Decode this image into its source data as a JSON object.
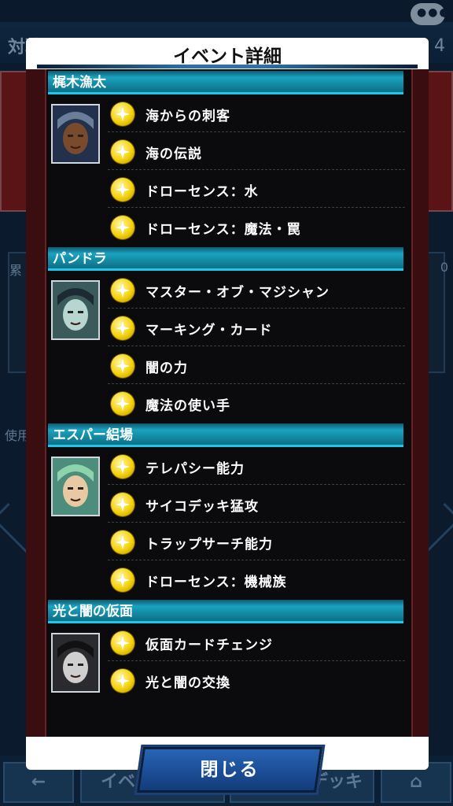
{
  "background": {
    "title": "対戦",
    "number": "4",
    "side_label_1": "累",
    "side_label_2": "使用",
    "right_value": "0",
    "bottom_buttons": [
      "イベント詳細",
      "イベントデッキ"
    ]
  },
  "modal": {
    "title": "イベント詳細",
    "close_label": "閉じる",
    "groups": [
      {
        "name": "梶木漁太",
        "items": [
          "海からの刺客",
          "海の伝説",
          "ドローセンス：水",
          "ドローセンス：魔法・罠"
        ]
      },
      {
        "name": "パンドラ",
        "items": [
          "マスター・オブ・マジシャン",
          "マーキング・カード",
          "闇の力",
          "魔法の使い手"
        ]
      },
      {
        "name": "エスパー絽場",
        "items": [
          "テレパシー能力",
          "サイコデッキ猛攻",
          "トラップサーチ能力",
          "ドローセンス：機械族"
        ]
      },
      {
        "name": "光と闇の仮面",
        "items": [
          "仮面カードチェンジ",
          "光と闇の交換"
        ]
      }
    ]
  },
  "icons": {
    "skill": "skill-star-coin-icon"
  },
  "colors": {
    "group_header": "#1aa2c0",
    "coin": "#f5d20a",
    "close_button": "#1b4d96"
  }
}
